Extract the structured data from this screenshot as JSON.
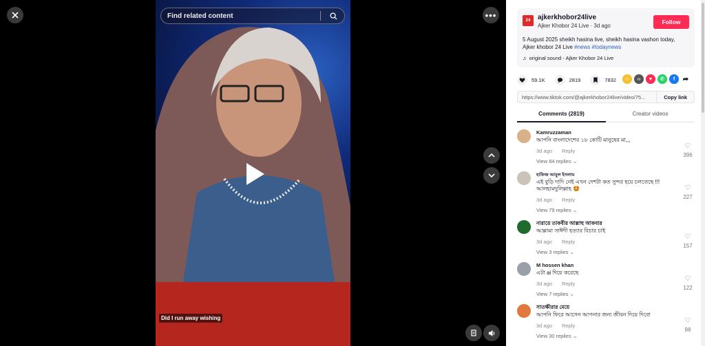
{
  "search": {
    "placeholder": "Find related content"
  },
  "video": {
    "caption": "Did I run away wishing"
  },
  "channel": {
    "name": "ajkerkhobor24live",
    "logo_text": "24",
    "meta": "Ajker Khobor 24 Live · 3d ago",
    "follow_label": "Follow"
  },
  "description": {
    "text": "5 August 2025 sheikh hasina live, sheikh hasina vashon today, Ajker khobor 24 Live",
    "tag1": "#news",
    "tag2": "#todaynews"
  },
  "sound": "original sound - Ajker Khobor 24 Live",
  "stats": {
    "likes": "59.1K",
    "comments": "2819",
    "saves": "7832"
  },
  "link": {
    "url": "https://www.tiktok.com/@ajkerkhobor24live/video/75...",
    "copy_label": "Copy link"
  },
  "tabs": [
    {
      "label": "Comments (2819)"
    },
    {
      "label": "Creator videos"
    }
  ],
  "comments": [
    {
      "user": "Kamruzzaman",
      "text": "আপনি বাংলাদেশের ১৮ কোটি মানুষের মা,,,",
      "time": "3d ago",
      "reply": "Reply",
      "replies": "View 84 replies",
      "likes": "396",
      "avatar_color": "#d8b08a"
    },
    {
      "user": "হাফিজ আবুল ইসলাম",
      "text": "এই বুড়ি দাদি নেই এখন দেশটা কত সুন্দর হয়ে চলতেছে !!!আলহামদুলিল্লাহ 🤩",
      "time": "3d ago",
      "reply": "Reply",
      "replies": "View 79 replies",
      "likes": "227",
      "avatar_color": "#c9c3b8"
    },
    {
      "user": "নারায়ে তাকবীর আল্লাহু আকবার",
      "text": "আল্লামা সাঈদী হত্যার বিচার চাই",
      "time": "3d ago",
      "reply": "Reply",
      "replies": "View 3 replies",
      "likes": "157",
      "avatar_color": "#1f6b2e"
    },
    {
      "user": "M hossen khan",
      "text": "এটা ai দিয়ে করেছে",
      "time": "3d ago",
      "reply": "Reply",
      "replies": "View 7 replies",
      "likes": "122",
      "avatar_color": "#9aa0a8"
    },
    {
      "user": "সাতক্ষীরার মেয়ে",
      "text": "আপনি ফিরে আসেন আপনার জন্য জীবন দিয়ে দিবো",
      "time": "3d ago",
      "reply": "Reply",
      "replies": "View 30 replies",
      "likes": "98",
      "avatar_color": "#e07840"
    }
  ],
  "colors": {
    "follow": "#fe2c55",
    "video_bottom": "#b5261e",
    "hashtag": "#2b5db9"
  }
}
